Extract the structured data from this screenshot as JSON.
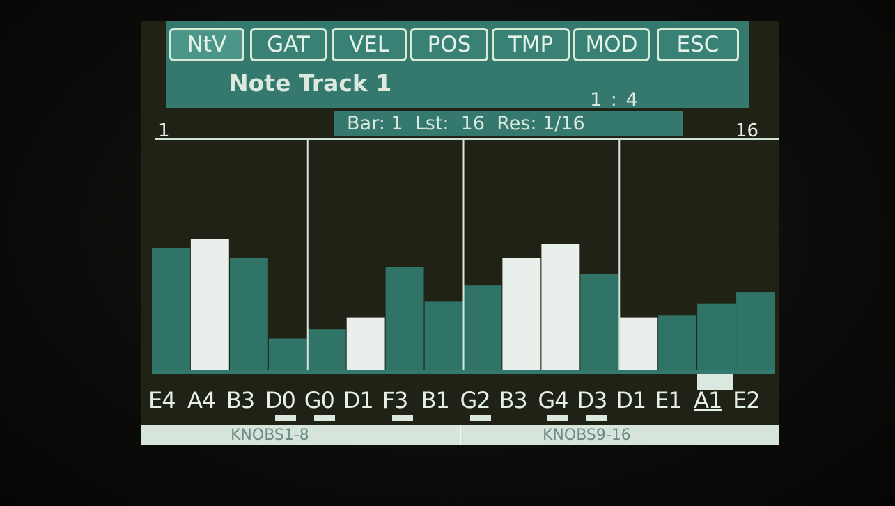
{
  "tabs": [
    {
      "label": "NtV",
      "active": true
    },
    {
      "label": "GAT",
      "active": false
    },
    {
      "label": "VEL",
      "active": false
    },
    {
      "label": "POS",
      "active": false
    },
    {
      "label": "TMP",
      "active": false
    },
    {
      "label": "MOD",
      "active": false
    },
    {
      "label": "ESC",
      "active": false
    }
  ],
  "track_title": "Note Track 1",
  "position_counter": "1 : 4",
  "start_step": "1",
  "end_step": "16",
  "info": "Bar: 1  Lst:  16  Res: 1/16",
  "steps": [
    {
      "note": "E4",
      "level": 0.53,
      "highlight": false,
      "knob_indicator": false
    },
    {
      "note": "A4",
      "level": 0.57,
      "highlight": true,
      "knob_indicator": false
    },
    {
      "note": "B3",
      "level": 0.49,
      "highlight": false,
      "knob_indicator": false
    },
    {
      "note": "D0",
      "level": 0.14,
      "highlight": false,
      "knob_indicator": true
    },
    {
      "note": "G0",
      "level": 0.18,
      "highlight": false,
      "knob_indicator": true
    },
    {
      "note": "D1",
      "level": 0.23,
      "highlight": true,
      "knob_indicator": false
    },
    {
      "note": "F3",
      "level": 0.45,
      "highlight": false,
      "knob_indicator": true
    },
    {
      "note": "B1",
      "level": 0.3,
      "highlight": false,
      "knob_indicator": false
    },
    {
      "note": "G2",
      "level": 0.37,
      "highlight": false,
      "knob_indicator": true
    },
    {
      "note": "B3",
      "level": 0.49,
      "highlight": true,
      "knob_indicator": false
    },
    {
      "note": "G4",
      "level": 0.55,
      "highlight": true,
      "knob_indicator": true
    },
    {
      "note": "D3",
      "level": 0.42,
      "highlight": false,
      "knob_indicator": true
    },
    {
      "note": "D1",
      "level": 0.23,
      "highlight": true,
      "knob_indicator": false
    },
    {
      "note": "E1",
      "level": 0.24,
      "highlight": false,
      "knob_indicator": false
    },
    {
      "note": "A1",
      "level": 0.29,
      "highlight": false,
      "knob_indicator": false,
      "selected": true
    },
    {
      "note": "E2",
      "level": 0.34,
      "highlight": false,
      "knob_indicator": false
    }
  ],
  "knob_groups": [
    "KNOBS1-8",
    "KNOBS9-16"
  ],
  "colors": {
    "screen_bg": "#1f2214",
    "accent_teal": "#35786d",
    "bar_teal": "#2f7466",
    "bar_highlight": "#e9efea",
    "text_light": "#dbe9df",
    "knob_bar": "#d6e4dc"
  }
}
